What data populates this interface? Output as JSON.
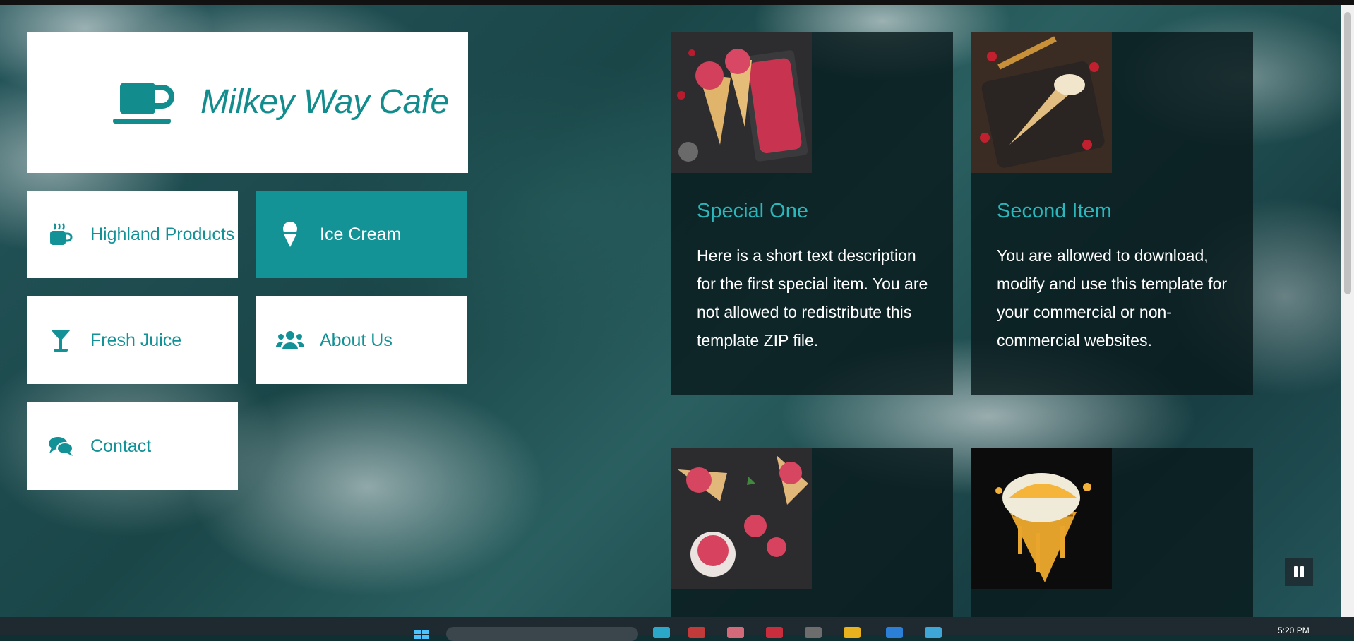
{
  "site": {
    "name": "Milkey Way Cafe",
    "logo_icon": "coffee-cup-icon"
  },
  "nav": [
    {
      "label": "Highland Products",
      "icon": "mug-steam-icon",
      "active": false
    },
    {
      "label": "Ice Cream",
      "icon": "ice-cream-icon",
      "active": true
    },
    {
      "label": "Fresh Juice",
      "icon": "cocktail-glass-icon",
      "active": false
    },
    {
      "label": "About Us",
      "icon": "users-icon",
      "active": false
    },
    {
      "label": "Contact",
      "icon": "comments-icon",
      "active": false
    }
  ],
  "cards": [
    {
      "title": "Special One",
      "description": "Here is a short text description for the first special item. You are not allowed to redistribute this template ZIP file.",
      "image": "ice-cream-cones-image"
    },
    {
      "title": "Second Item",
      "description": "You are allowed to download, modify and use this template for your commercial or non-commercial websites.",
      "image": "ice-cream-cone-tray-image"
    },
    {
      "title": "",
      "description": "",
      "image": "ice-cream-scoops-image"
    },
    {
      "title": "",
      "description": "",
      "image": "honeycomb-cone-image"
    }
  ],
  "colors": {
    "brand_teal": "#149396",
    "title_teal": "#2ab8bd",
    "card_bg": "#081a1c"
  },
  "taskbar": {
    "clock": "5:20 PM"
  }
}
